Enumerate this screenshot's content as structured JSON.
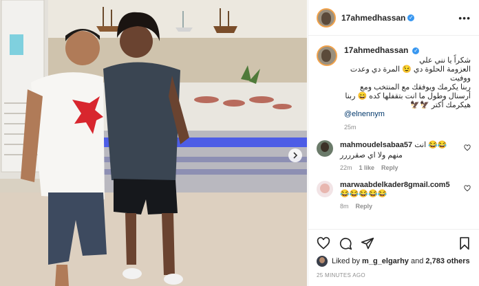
{
  "post": {
    "username": "17ahmedhassan",
    "verified_icon": "verified-badge-icon",
    "more_icon": "ellipsis-icon"
  },
  "caption": {
    "username": "17ahmedhassan",
    "text": "شكراً يا نني علي\nالعزومة الحلوة دي 😉 المرة دي وعدت\nووفيت\nربنا يكرمك ويوفقك مع المنتخب ومع\nأرسنال وطول ما انت بتقفلها كده 😄 ربنا\nهيكرمك أكتر 🦅🦅",
    "mention": "@elnennym",
    "time": "25m"
  },
  "comments": [
    {
      "username": "mahmoudelsabaa57",
      "text": "انت 😂😂",
      "text2": "منهم ولا اي صقرررر",
      "time": "22m",
      "likes": "1 like",
      "reply": "Reply"
    },
    {
      "username": "marwaabdelkader8gmail.com5",
      "text": "😂😂😂😂😂",
      "time": "8m",
      "reply": "Reply"
    }
  ],
  "likes": {
    "prefix": "Liked by ",
    "user": "m_g_elgarhy",
    "mid": " and ",
    "count": "2,783 others"
  },
  "timestamp": "25 MINUTES AGO",
  "colors": {
    "verified": "#3897f0",
    "text": "#262626",
    "muted": "#8e8e8e",
    "mention": "#00376b"
  }
}
